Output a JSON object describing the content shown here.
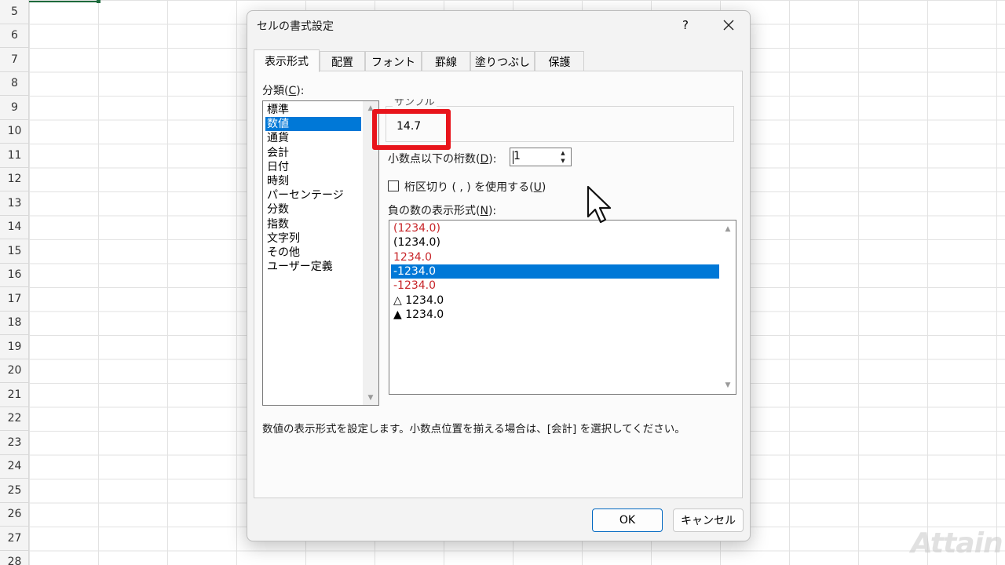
{
  "sheet": {
    "row_numbers": [
      "5",
      "6",
      "7",
      "8",
      "9",
      "10",
      "11",
      "12",
      "13",
      "14",
      "15",
      "16",
      "17",
      "18",
      "19",
      "20",
      "21",
      "22",
      "23",
      "24",
      "25",
      "26",
      "27",
      "28"
    ]
  },
  "dialog": {
    "title": "セルの書式設定",
    "help_label": "?",
    "close_icon": "close-icon",
    "tabs": [
      {
        "label": "表示形式",
        "active": true
      },
      {
        "label": "配置",
        "active": false
      },
      {
        "label": "フォント",
        "active": false
      },
      {
        "label": "罫線",
        "active": false
      },
      {
        "label": "塗りつぶし",
        "active": false
      },
      {
        "label": "保護",
        "active": false
      }
    ],
    "category_label": "分類(",
    "category_key": "C",
    "category_label_end": "):",
    "categories": [
      {
        "label": "標準",
        "selected": false
      },
      {
        "label": "数値",
        "selected": true
      },
      {
        "label": "通貨",
        "selected": false
      },
      {
        "label": "会計",
        "selected": false
      },
      {
        "label": "日付",
        "selected": false
      },
      {
        "label": "時刻",
        "selected": false
      },
      {
        "label": "パーセンテージ",
        "selected": false
      },
      {
        "label": "分数",
        "selected": false
      },
      {
        "label": "指数",
        "selected": false
      },
      {
        "label": "文字列",
        "selected": false
      },
      {
        "label": "その他",
        "selected": false
      },
      {
        "label": "ユーザー定義",
        "selected": false
      }
    ],
    "sample_label": "サンプル",
    "sample_value": "14.7",
    "decimal_label": "小数点以下の桁数(",
    "decimal_key": "D",
    "decimal_label_end": "):",
    "decimal_value": "1",
    "thousands_label": "桁区切り ( , ) を使用する(",
    "thousands_key": "U",
    "thousands_label_end": ")",
    "thousands_checked": false,
    "negative_label": "負の数の表示形式(",
    "negative_key": "N",
    "negative_label_end": "):",
    "negative_formats": [
      {
        "label": "(1234.0)",
        "red": true,
        "selected": false
      },
      {
        "label": "(1234.0)",
        "red": false,
        "selected": false
      },
      {
        "label": "1234.0",
        "red": true,
        "selected": false
      },
      {
        "label": "-1234.0",
        "red": false,
        "selected": true
      },
      {
        "label": "-1234.0",
        "red": true,
        "selected": false
      },
      {
        "label": "△ 1234.0",
        "red": false,
        "selected": false
      },
      {
        "label": "▲ 1234.0",
        "red": false,
        "selected": false
      }
    ],
    "description": "数値の表示形式を設定します。小数点位置を揃える場合は、[会計] を選択してください。",
    "ok_label": "OK",
    "cancel_label": "キャンセル"
  },
  "colors": {
    "selection": "#0078d7",
    "negative_red": "#c8262a",
    "highlight_box": "#e8141b"
  },
  "watermark": "Attain"
}
